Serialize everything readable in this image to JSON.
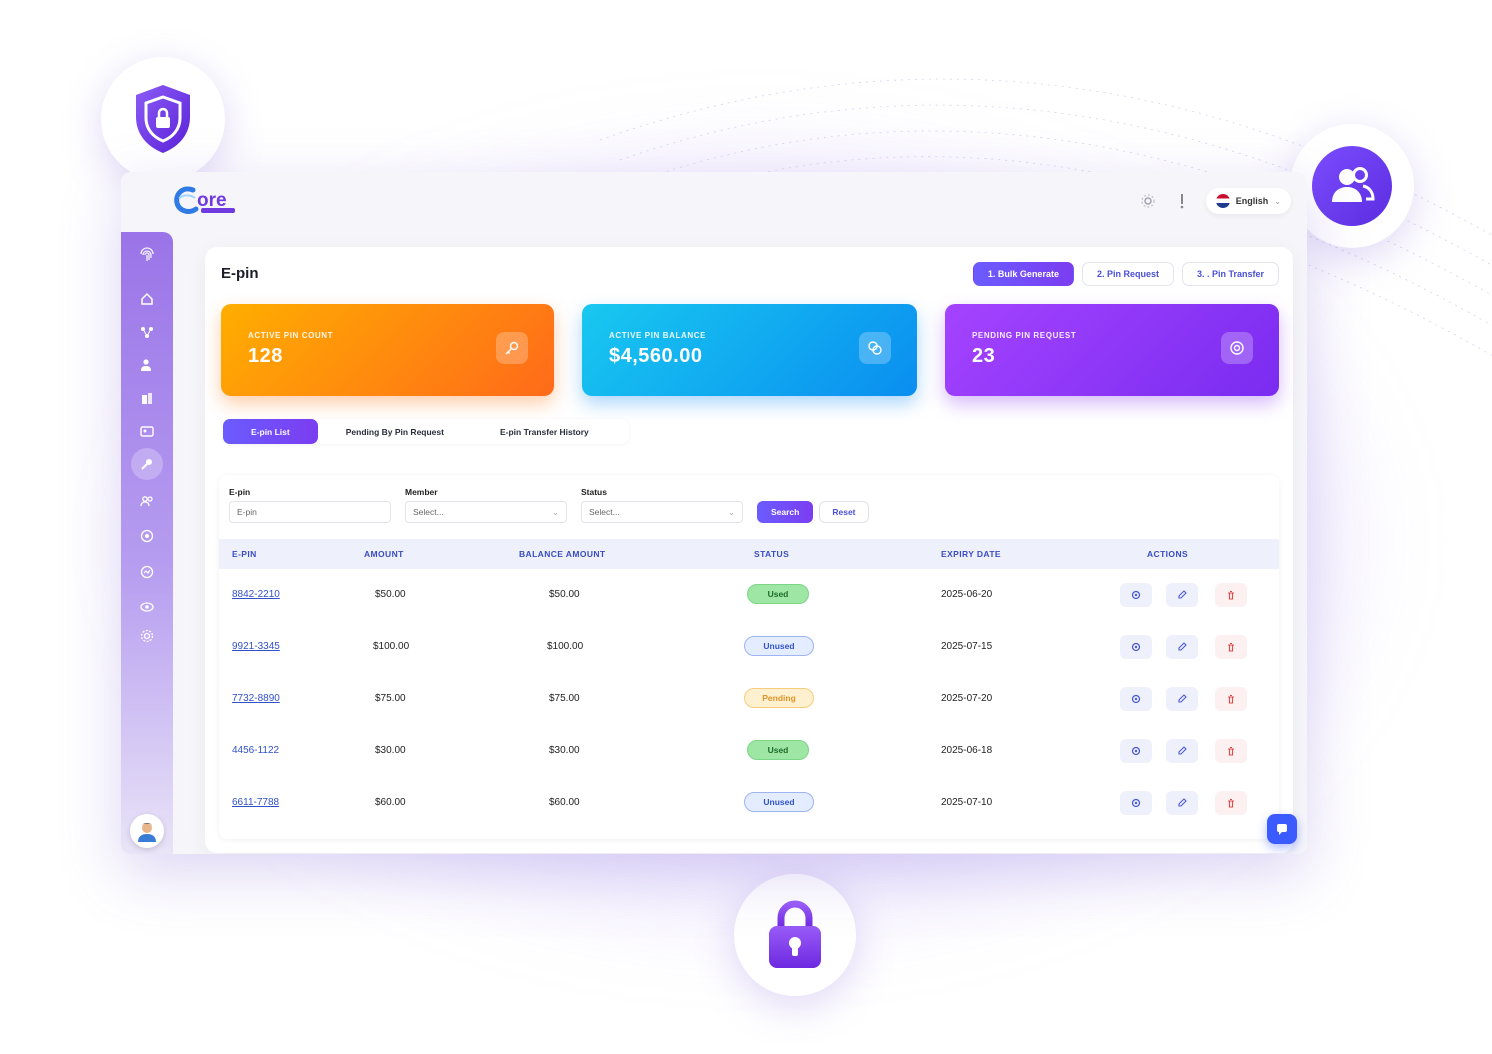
{
  "brand": {
    "logo_text": "ore"
  },
  "header": {
    "language": "English"
  },
  "page": {
    "title": "E-pin"
  },
  "top_tabs": [
    {
      "label": "1. Bulk Generate",
      "active": true
    },
    {
      "label": "2. Pin Request",
      "active": false
    },
    {
      "label": "3. . Pin Transfer",
      "active": false
    }
  ],
  "stats": [
    {
      "label": "ACTIVE PIN COUNT",
      "value": "128",
      "icon": "key-icon",
      "color": "#ff8a10"
    },
    {
      "label": "ACTIVE PIN BALANCE",
      "value": "$4,560.00",
      "icon": "coins-icon",
      "color": "#10a8f0"
    },
    {
      "label": "PENDING PIN REQUEST",
      "value": "23",
      "icon": "clock-icon",
      "color": "#8e38f8"
    }
  ],
  "sub_tabs": [
    {
      "label": "E-pin List",
      "active": true
    },
    {
      "label": "Pending By Pin Request",
      "active": false
    },
    {
      "label": "E-pin Transfer History",
      "active": false
    }
  ],
  "filters": {
    "epin_label": "E-pin",
    "epin_placeholder": "E-pin",
    "member_label": "Member",
    "member_value": "Select...",
    "status_label": "Status",
    "status_value": "Select...",
    "search_label": "Search",
    "reset_label": "Reset"
  },
  "table": {
    "headers": [
      "E-PIN",
      "AMOUNT",
      "BALANCE AMOUNT",
      "STATUS",
      "EXPIRY DATE",
      "ACTIONS"
    ],
    "rows": [
      {
        "epin": "8842-2210",
        "amount": "$50.00",
        "balance": "$50.00",
        "status": "Used",
        "expiry": "2025-06-20"
      },
      {
        "epin": "9921-3345",
        "amount": "$100.00",
        "balance": "$100.00",
        "status": "Unused",
        "expiry": "2025-07-15"
      },
      {
        "epin": "7732-8890",
        "amount": "$75.00",
        "balance": "$75.00",
        "status": "Pending",
        "expiry": "2025-07-20"
      },
      {
        "epin": "4456-1122",
        "amount": "$30.00",
        "balance": "$30.00",
        "status": "Used",
        "expiry": "2025-06-18"
      },
      {
        "epin": "6611-7788",
        "amount": "$60.00",
        "balance": "$60.00",
        "status": "Unused",
        "expiry": "2025-07-10"
      }
    ]
  },
  "colors": {
    "accent": "#6a5cff",
    "sidebar": "#9a74e8",
    "link": "#3050c8"
  }
}
